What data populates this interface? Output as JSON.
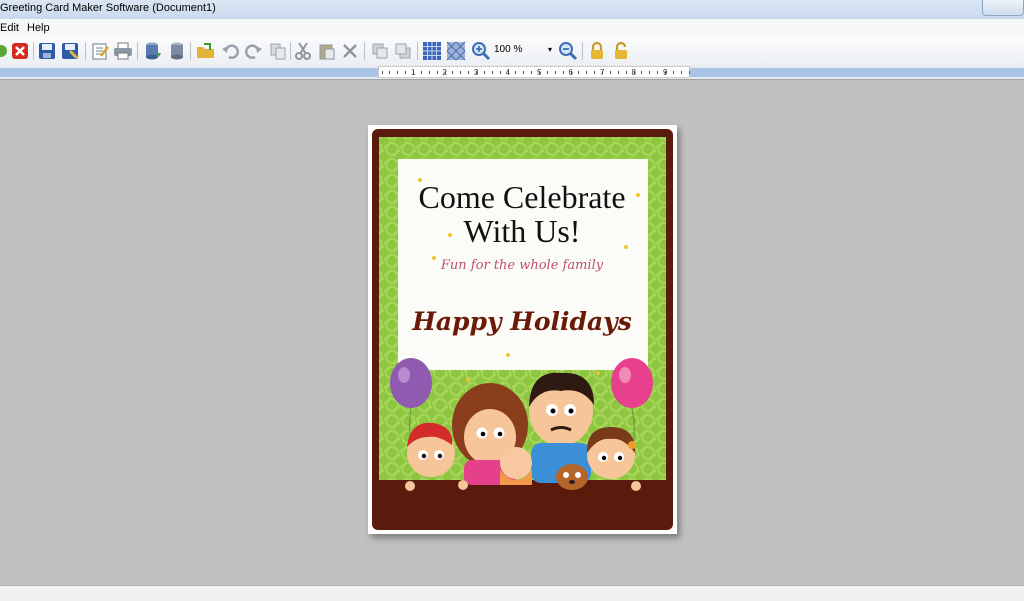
{
  "window": {
    "title": "Greeting Card Maker Software  (Document1)"
  },
  "menu": {
    "items": [
      "Edit",
      "Help"
    ]
  },
  "toolbar": {
    "zoom_value": "100 %",
    "buttons": [
      "new-icon",
      "close-icon",
      "save-icon",
      "save-as-icon",
      "edit-icon",
      "print-icon",
      "database-icon",
      "database-export-icon",
      "open-folder-icon",
      "undo-icon",
      "redo-icon",
      "copy-icon",
      "cut-icon",
      "paste-icon",
      "delete-icon",
      "bring-front-icon",
      "send-back-icon",
      "grid-icon",
      "pattern-grid-icon",
      "zoom-in-icon",
      "zoom-out-icon",
      "lock-icon",
      "unlock-icon"
    ]
  },
  "ruler": {
    "labels": [
      "1",
      "2",
      "3",
      "4",
      "5",
      "6",
      "7",
      "8",
      "9"
    ]
  },
  "card": {
    "headline_line1": "Come Celebrate",
    "headline_line2": "With Us!",
    "tagline": "Fun for the whole family",
    "greeting": "Happy Holidays"
  },
  "colors": {
    "card_border": "#5a1a0c",
    "card_green": "#8dc63f",
    "greeting_text": "#6b1a08",
    "tagline_text": "#c0506a",
    "toolbar_bg": "#f4f6f8",
    "canvas_bg": "#c0c0c0"
  }
}
